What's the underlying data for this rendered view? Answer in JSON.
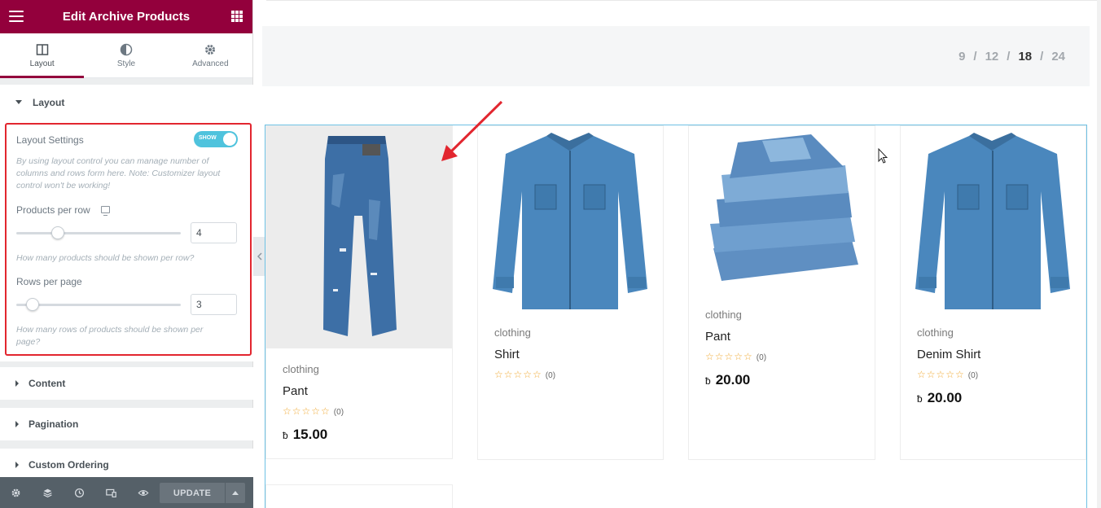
{
  "editor": {
    "title": "Edit Archive Products",
    "tabs": [
      {
        "label": "Layout",
        "icon": "columns-icon"
      },
      {
        "label": "Style",
        "icon": "half-circle-icon"
      },
      {
        "label": "Advanced",
        "icon": "gear-icon"
      }
    ],
    "active_tab": "Layout",
    "sections": {
      "layout": "Layout",
      "content": "Content",
      "pagination": "Pagination",
      "custom_ordering": "Custom Ordering"
    },
    "layout_settings": {
      "label": "Layout Settings",
      "toggle_text": "SHOW",
      "toggle_on": true,
      "description": "By using layout control you can manage number of columns and rows form here. Note: Customizer layout control won't be working!",
      "products_per_row": {
        "label": "Products per row",
        "value": "4",
        "slider_fraction": 0.25,
        "help": "How many products should be shown per row?"
      },
      "rows_per_page": {
        "label": "Rows per page",
        "value": "3",
        "slider_fraction": 0.1,
        "help": "How many rows of products should be shown per page?"
      }
    },
    "footer": {
      "icons": [
        "settings-icon",
        "layers-icon",
        "history-icon",
        "responsive-icon",
        "preview-eye-icon"
      ],
      "update_label": "UPDATE"
    }
  },
  "preview": {
    "per_page_options": [
      "9",
      "12",
      "18",
      "24"
    ],
    "per_page_separator": "/",
    "per_page_current": "18",
    "products": [
      {
        "category": "clothing",
        "name": "Pant",
        "rating_count": "(0)",
        "currency": "ƀ",
        "price": "15.00",
        "image": "jeans"
      },
      {
        "category": "clothing",
        "name": "Shirt",
        "rating_count": "(0)",
        "currency": "ƀ",
        "price": "",
        "image": "denim-shirt"
      },
      {
        "category": "clothing",
        "name": "Pant",
        "rating_count": "(0)",
        "currency": "ƀ",
        "price": "20.00",
        "image": "folded-jeans"
      },
      {
        "category": "clothing",
        "name": "Denim Shirt",
        "rating_count": "(0)",
        "currency": "ƀ",
        "price": "20.00",
        "image": "denim-shirt"
      }
    ],
    "colors": {
      "brand": "#93003c",
      "highlight": "#e2262f",
      "toggle": "#4fc3dd",
      "star": "#f0a830",
      "frame": "#6ec1e4"
    }
  }
}
